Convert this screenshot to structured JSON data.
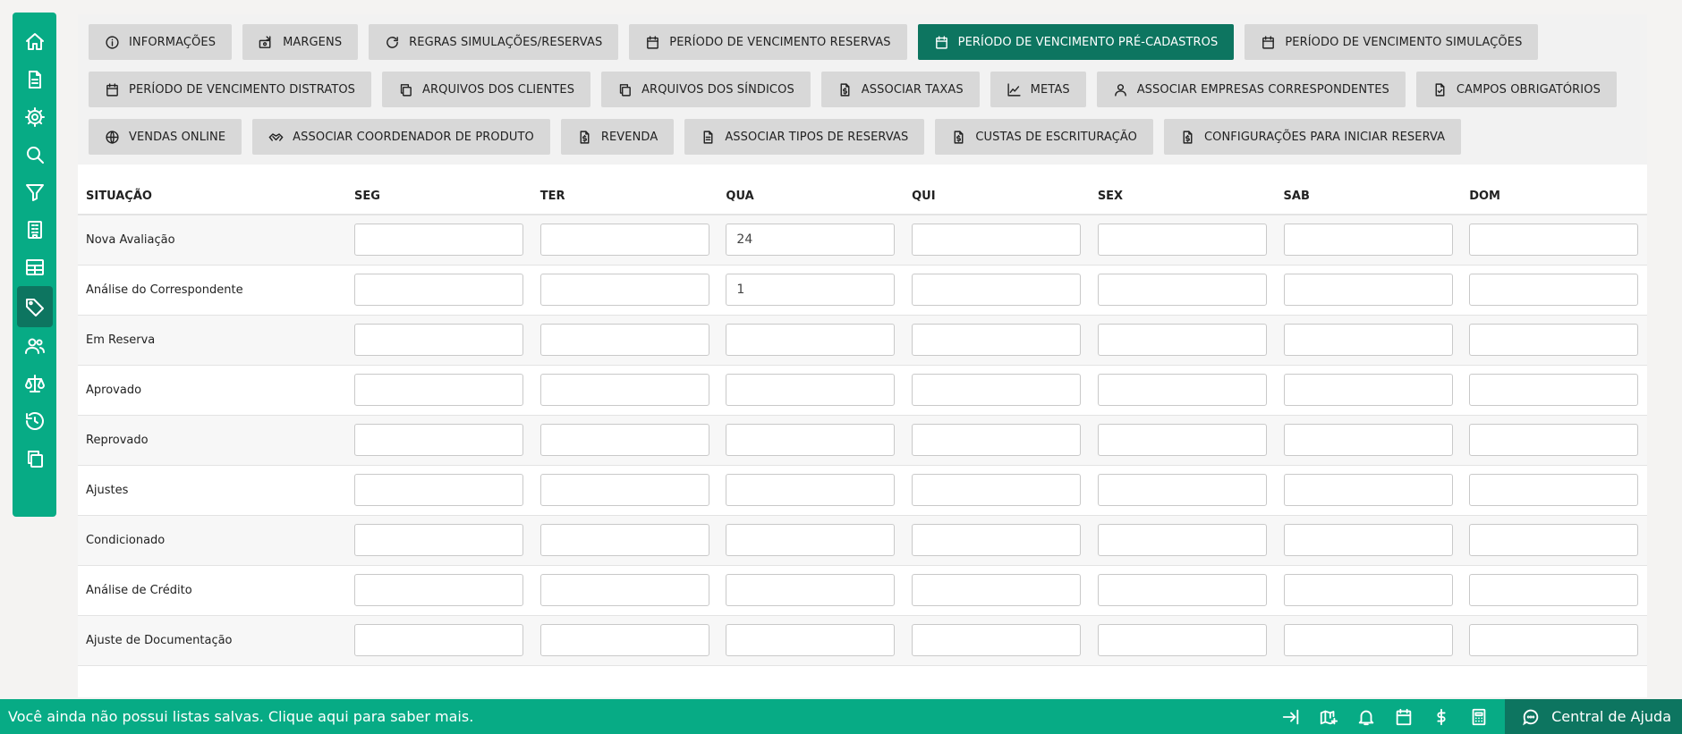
{
  "tabs": [
    {
      "label": "INFORMAÇÕES",
      "icon": "info-icon"
    },
    {
      "label": "MARGENS",
      "icon": "money-icon"
    },
    {
      "label": "REGRAS SIMULAÇÕES/RESERVAS",
      "icon": "refresh-icon"
    },
    {
      "label": "PERÍODO DE VENCIMENTO RESERVAS",
      "icon": "calendar-icon"
    },
    {
      "label": "PERÍODO DE VENCIMENTO PRÉ-CADASTROS",
      "icon": "calendar-icon",
      "active": true
    },
    {
      "label": "PERÍODO DE VENCIMENTO SIMULAÇÕES",
      "icon": "calendar-icon"
    },
    {
      "label": "PERÍODO DE VENCIMENTO DISTRATOS",
      "icon": "calendar-icon"
    },
    {
      "label": "ARQUIVOS DOS CLIENTES",
      "icon": "copy-icon"
    },
    {
      "label": "ARQUIVOS DOS SÍNDICOS",
      "icon": "copy-icon"
    },
    {
      "label": "ASSOCIAR TAXAS",
      "icon": "document-dollar-icon"
    },
    {
      "label": "METAS",
      "icon": "chart-line-icon"
    },
    {
      "label": "ASSOCIAR EMPRESAS CORRESPONDENTES",
      "icon": "user-icon"
    },
    {
      "label": "CAMPOS OBRIGATÓRIOS",
      "icon": "document-check-icon"
    },
    {
      "label": "VENDAS ONLINE",
      "icon": "globe-icon"
    },
    {
      "label": "ASSOCIAR COORDENADOR DE PRODUTO",
      "icon": "handshake-icon"
    },
    {
      "label": "REVENDA",
      "icon": "document-dollar-icon"
    },
    {
      "label": "ASSOCIAR TIPOS DE RESERVAS",
      "icon": "document-icon"
    },
    {
      "label": "CUSTAS DE ESCRITURAÇÃO",
      "icon": "document-dollar-icon"
    },
    {
      "label": "CONFIGURAÇÕES PARA INICIAR RESERVA",
      "icon": "document-dollar-icon"
    }
  ],
  "table": {
    "headers": [
      "SITUAÇÃO",
      "SEG",
      "TER",
      "QUA",
      "QUI",
      "SEX",
      "SAB",
      "DOM"
    ],
    "rows": [
      {
        "label": "Nova Avaliação",
        "values": [
          "",
          "",
          "24",
          "",
          "",
          "",
          ""
        ]
      },
      {
        "label": "Análise do Correspondente",
        "values": [
          "",
          "",
          "1",
          "",
          "",
          "",
          ""
        ]
      },
      {
        "label": "Em Reserva",
        "values": [
          "",
          "",
          "",
          "",
          "",
          "",
          ""
        ]
      },
      {
        "label": "Aprovado",
        "values": [
          "",
          "",
          "",
          "",
          "",
          "",
          ""
        ]
      },
      {
        "label": "Reprovado",
        "values": [
          "",
          "",
          "",
          "",
          "",
          "",
          ""
        ]
      },
      {
        "label": "Ajustes",
        "values": [
          "",
          "",
          "",
          "",
          "",
          "",
          ""
        ]
      },
      {
        "label": "Condicionado",
        "values": [
          "",
          "",
          "",
          "",
          "",
          "",
          ""
        ]
      },
      {
        "label": "Análise de Crédito",
        "values": [
          "",
          "",
          "",
          "",
          "",
          "",
          ""
        ]
      },
      {
        "label": "Ajuste de Documentação",
        "values": [
          "",
          "",
          "",
          "",
          "",
          "",
          ""
        ]
      }
    ]
  },
  "sidebar": {
    "items": [
      "home-icon",
      "document-icon",
      "gear-icon",
      "search-icon",
      "filter-icon",
      "building-icon",
      "table-icon",
      "tag-icon",
      "users-icon",
      "scale-icon",
      "history-icon",
      "copy-icon"
    ],
    "active_index": 7
  },
  "footer": {
    "message": "Você ainda não possui listas salvas. Clique aqui para saber mais.",
    "icons": [
      "collapse-arrow-icon",
      "map-add-icon",
      "bell-icon",
      "calendar-icon",
      "dollar-icon",
      "calculator-icon"
    ],
    "help_label": "Central de Ajuda"
  },
  "colors": {
    "brand": "#07ab85",
    "brand_dark": "#0d7560"
  }
}
